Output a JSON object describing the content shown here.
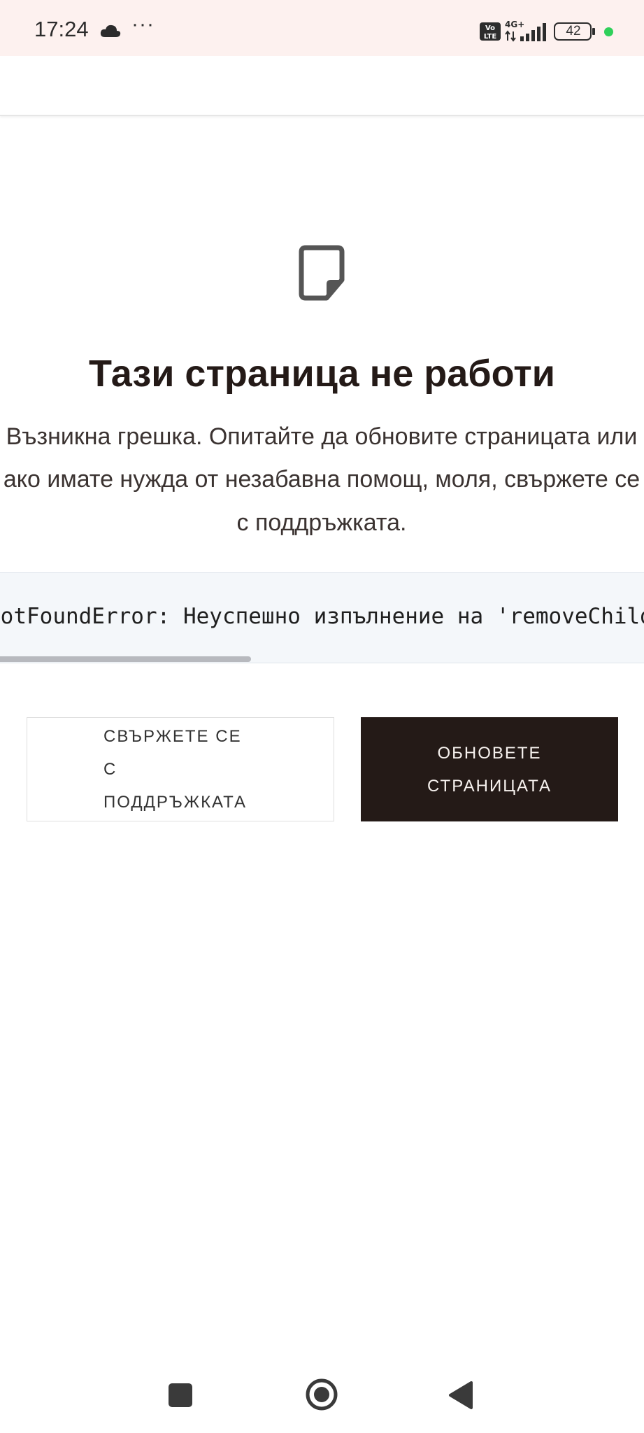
{
  "status_bar": {
    "time": "17:24",
    "dots": "···",
    "network": "4G+",
    "battery": "42",
    "volte": "Vo LTE"
  },
  "error_page": {
    "title": "Тази страница не работи",
    "description_lines": [
      "Възникна грешка. Опитайте да обновите страницата или",
      "ако имате нужда от незабавна помощ, моля, свържете се",
      "с поддръжката."
    ],
    "error_message": "NotFoundError: Неуспешно изпълнение на 'removeChild'",
    "contact_support_label": "СВЪРЖЕТЕ СЕ С ПОДДРЪЖКАТА",
    "refresh_label": "ОБНОВЕТЕ СТРАНИЦАТА",
    "error_scroll_fraction": 0.39
  },
  "colors": {
    "status_bar_bg": "#fdf1ef",
    "primary_dark": "#241a17",
    "error_box_bg": "#f4f7fa",
    "indicator_green": "#2fd05a"
  },
  "icons": {
    "page": "document-page-icon",
    "cloud": "cloud-icon",
    "signal": "cellular-signal-icon",
    "battery": "battery-icon",
    "nav_recent": "square-recents-icon",
    "nav_home": "circle-home-icon",
    "nav_back": "triangle-back-icon"
  }
}
